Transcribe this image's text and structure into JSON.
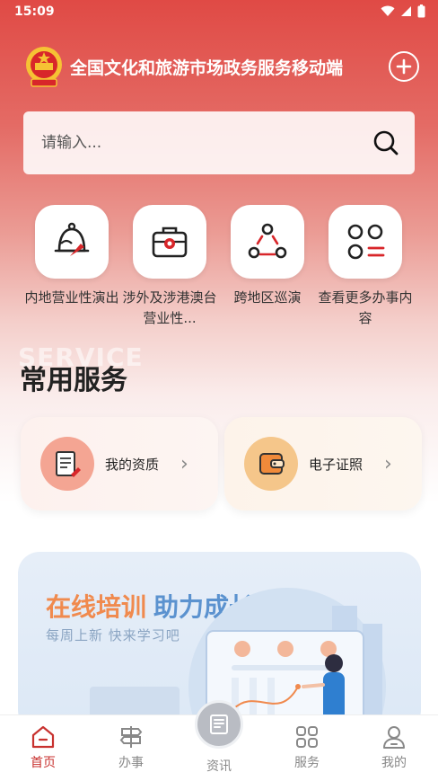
{
  "status_bar": {
    "time": "15:09"
  },
  "header": {
    "title": "全国文化和旅游市场政务服务移动端"
  },
  "search": {
    "placeholder": "请输入..."
  },
  "quick_actions": [
    {
      "label": "内地营业性演出",
      "icon": "bell-performance-icon"
    },
    {
      "label": "涉外及涉港澳台营业性...",
      "icon": "briefcase-icon"
    },
    {
      "label": "跨地区巡演",
      "icon": "route-nodes-icon"
    },
    {
      "label": "查看更多办事内容",
      "icon": "grid-menu-icon"
    }
  ],
  "watermark": "SERVICE",
  "common_services": {
    "title": "常用服务",
    "cards": [
      {
        "label": "我的资质",
        "icon": "document-stamp-icon"
      },
      {
        "label": "电子证照",
        "icon": "wallet-icon"
      }
    ]
  },
  "banner": {
    "title_part1": "在线培训",
    "title_part2": "助力成长",
    "subtitle": "每周上新  快来学习吧"
  },
  "bottom_nav": {
    "items": [
      {
        "label": "首页",
        "icon": "home-icon",
        "active": true
      },
      {
        "label": "办事",
        "icon": "signpost-icon",
        "active": false
      },
      {
        "label": "资讯",
        "icon": "news-icon",
        "active": false
      },
      {
        "label": "服务",
        "icon": "grid-icon",
        "active": false
      },
      {
        "label": "我的",
        "icon": "user-icon",
        "active": false
      }
    ]
  },
  "colors": {
    "primary": "#d9413c",
    "active_tab": "#c8322f"
  }
}
